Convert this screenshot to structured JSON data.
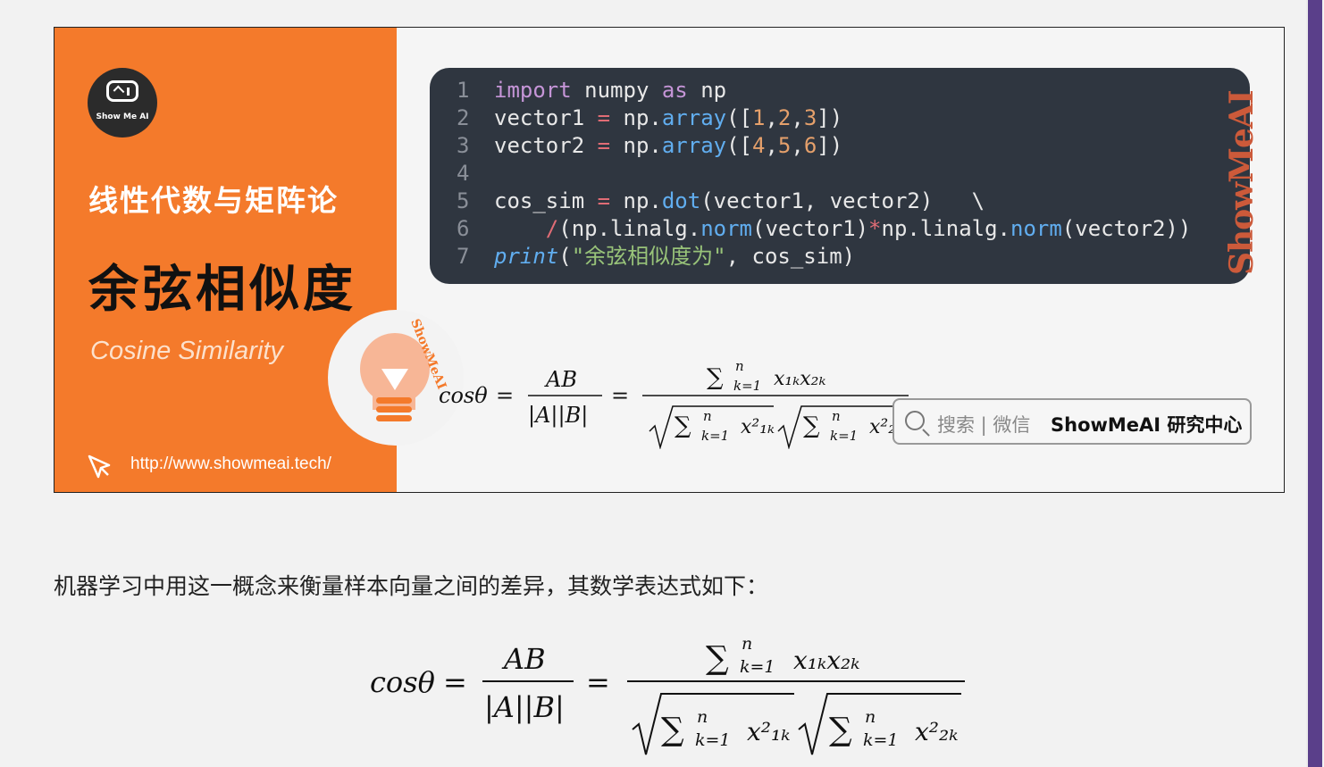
{
  "banner": {
    "logo_text": "Show Me AI",
    "title_main": "线性代数与矩阵论",
    "title_sub": "余弦相似度",
    "subtitle_en": "Cosine Similarity",
    "url": "http://www.showmeai.tech/",
    "bulb_watermark": "ShowMeAI",
    "code_watermark": "ShowMeAI",
    "code_lines": [
      {
        "n": "1"
      },
      {
        "n": "2"
      },
      {
        "n": "3"
      },
      {
        "n": "4"
      },
      {
        "n": "5"
      },
      {
        "n": "6"
      },
      {
        "n": "7"
      }
    ],
    "search_prefix": "搜索 | 微信",
    "search_brand": "ShowMeAI 研究中心"
  },
  "article": {
    "paragraph": "机器学习中用这一概念来衡量样本向量之间的差异，其数学表达式如下："
  },
  "formula": {
    "lhs": "cosθ",
    "num1": "AB",
    "den1": "|A||B|",
    "sum_upper": "n",
    "sum_lower": "k=1",
    "term_num": "x₁ₖx₂ₖ",
    "term_den1": "x²₁ₖ",
    "term_den2": "x²₂ₖ"
  }
}
